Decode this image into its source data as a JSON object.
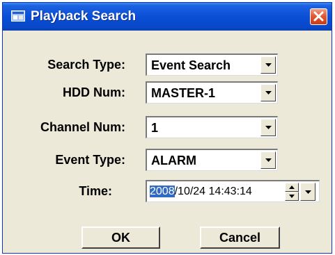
{
  "window": {
    "title": "Playback Search",
    "title_icon": "playback-icon",
    "close_icon": "close-x-icon"
  },
  "form": {
    "search_type": {
      "label": "Search Type:",
      "value": "Event Search"
    },
    "hdd_num": {
      "label": "HDD Num:",
      "value": "MASTER-1"
    },
    "channel_num": {
      "label": "Channel Num:",
      "value": "1"
    },
    "event_type": {
      "label": "Event Type:",
      "value": "ALARM"
    },
    "time": {
      "label": "Time:",
      "year": "2008",
      "rest": "/10/24 14:43:14"
    }
  },
  "buttons": {
    "ok": "OK",
    "cancel": "Cancel"
  },
  "colors": {
    "title_bar": "#0a4fd6",
    "dialog_bg": "#ece9d8",
    "selection": "#316ac5",
    "close_button": "#e25a35"
  }
}
